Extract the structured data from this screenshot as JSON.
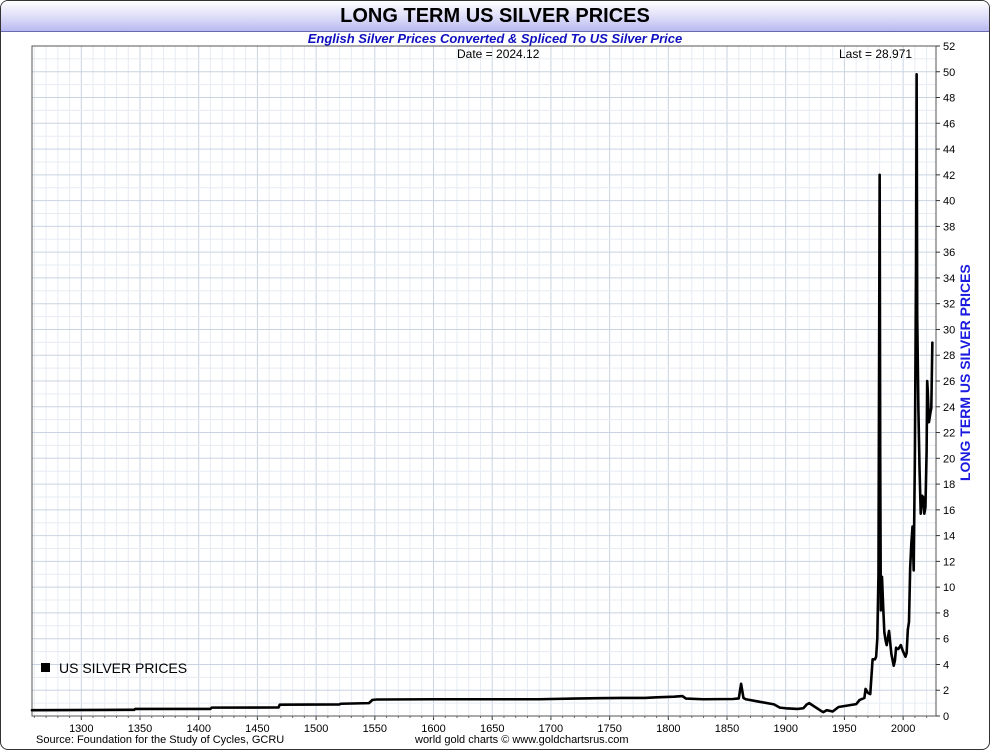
{
  "chart_data": {
    "type": "line",
    "title": "LONG TERM US SILVER PRICES",
    "subtitle": "English Silver Prices Converted & Spliced To US Silver Price",
    "ylabel": "LONG TERM US SILVER PRICES",
    "xlim": [
      1258,
      2028
    ],
    "ylim": [
      0,
      52
    ],
    "x_ticks": [
      1300,
      1350,
      1400,
      1450,
      1500,
      1550,
      1600,
      1650,
      1700,
      1750,
      1800,
      1850,
      1900,
      1950,
      2000
    ],
    "y_ticks": [
      0,
      2,
      4,
      6,
      8,
      10,
      12,
      14,
      16,
      18,
      20,
      22,
      24,
      26,
      28,
      30,
      32,
      34,
      36,
      38,
      40,
      42,
      44,
      46,
      48,
      50,
      52
    ],
    "grid": true,
    "legend_position": "bottom-left",
    "series": [
      {
        "name": "US SILVER PRICES",
        "color": "#000000",
        "x": [
          1258,
          1320,
          1345,
          1346,
          1410,
          1411,
          1468,
          1469,
          1520,
          1521,
          1545,
          1548,
          1552,
          1600,
          1650,
          1690,
          1700,
          1720,
          1740,
          1760,
          1780,
          1790,
          1805,
          1812,
          1815,
          1830,
          1855,
          1860,
          1862,
          1864,
          1866,
          1875,
          1890,
          1895,
          1900,
          1910,
          1915,
          1918,
          1920,
          1930,
          1932,
          1935,
          1940,
          1945,
          1960,
          1963,
          1967,
          1968,
          1970,
          1972,
          1974,
          1976,
          1977,
          1978,
          1979,
          1980,
          1980.5,
          1981,
          1982,
          1983,
          1984,
          1985,
          1986,
          1988,
          1990,
          1992,
          1993,
          1994,
          1995,
          1996,
          1998,
          2000,
          2002,
          2003,
          2004,
          2005,
          2006,
          2007,
          2008,
          2009,
          2010,
          2011,
          2011.5,
          2012,
          2013,
          2014,
          2015,
          2016,
          2017,
          2018,
          2019,
          2020,
          2020.5,
          2021,
          2022,
          2023,
          2024,
          2024.9
        ],
        "values": [
          0.45,
          0.47,
          0.48,
          0.55,
          0.55,
          0.65,
          0.66,
          0.88,
          0.9,
          0.95,
          1.0,
          1.25,
          1.28,
          1.3,
          1.3,
          1.3,
          1.32,
          1.35,
          1.38,
          1.4,
          1.4,
          1.45,
          1.5,
          1.55,
          1.35,
          1.3,
          1.32,
          1.36,
          2.5,
          1.4,
          1.3,
          1.15,
          0.9,
          0.65,
          0.6,
          0.55,
          0.6,
          0.9,
          1.0,
          0.4,
          0.3,
          0.45,
          0.35,
          0.7,
          0.92,
          1.25,
          1.4,
          2.1,
          1.8,
          1.7,
          4.4,
          4.4,
          4.6,
          6.0,
          11.0,
          42.0,
          20.0,
          8.2,
          10.8,
          8.5,
          6.5,
          5.9,
          5.5,
          6.6,
          4.8,
          3.9,
          4.3,
          5.3,
          5.2,
          5.2,
          5.5,
          5.0,
          4.6,
          4.9,
          6.7,
          7.3,
          11.5,
          13.4,
          14.7,
          11.3,
          20.0,
          35.0,
          49.8,
          31.0,
          23.8,
          19.1,
          15.7,
          17.1,
          17.0,
          15.7,
          16.2,
          20.5,
          26.0,
          25.2,
          22.8,
          23.4,
          23.9,
          28.971
        ]
      }
    ]
  },
  "labels": {
    "date_label": "Date = 2024.12",
    "last_label": "Last = 28.971",
    "legend_label": "US SILVER PRICES",
    "source": "Source: Foundation for the Study of Cycles, GCRU",
    "credit": "world gold charts © www.goldchartsrus.com"
  }
}
